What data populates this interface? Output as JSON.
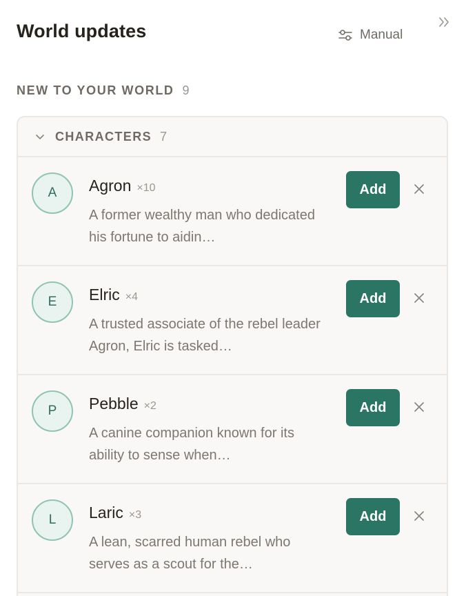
{
  "header": {
    "title": "World updates",
    "manual_label": "Manual",
    "manual_icon": "sliders-icon",
    "collapse_icon": "chevrons-right-icon"
  },
  "section": {
    "heading": "NEW TO YOUR WORLD",
    "count": "9"
  },
  "group": {
    "label": "CHARACTERS",
    "count": "7",
    "toggle_icon": "chevron-down-icon"
  },
  "items": [
    {
      "initial": "A",
      "name": "Agron",
      "mentions": "×10",
      "description": "A former wealthy man who dedicated his fortune to aidin…",
      "add_label": "Add"
    },
    {
      "initial": "E",
      "name": "Elric",
      "mentions": "×4",
      "description": "A trusted associate of the rebel leader Agron, Elric is tasked…",
      "add_label": "Add"
    },
    {
      "initial": "P",
      "name": "Pebble",
      "mentions": "×2",
      "description": "A canine companion known for its ability to sense when…",
      "add_label": "Add"
    },
    {
      "initial": "L",
      "name": "Laric",
      "mentions": "×3",
      "description": "A lean, scarred human rebel who serves as a scout for the…",
      "add_label": "Add"
    }
  ],
  "colors": {
    "accent": "#2a7564",
    "avatar_border": "#8fc4b3",
    "avatar_bg": "#e9f3ef",
    "card_bg": "#f9f8f6",
    "border": "#ebe7e2",
    "muted_text": "#7d7770"
  }
}
